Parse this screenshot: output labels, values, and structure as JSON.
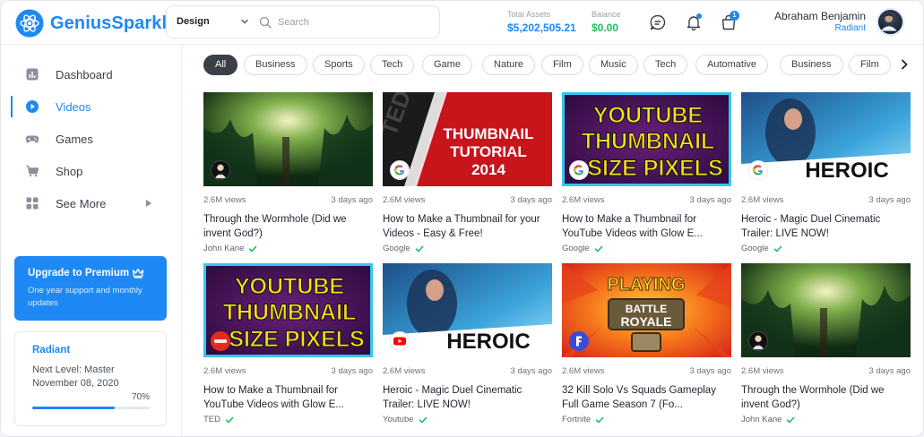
{
  "app": {
    "name": "GeniusSparkle"
  },
  "search": {
    "category": "Design",
    "placeholder": "Search"
  },
  "stats": {
    "total_assets_label": "Total Assets",
    "total_assets_value": "$5,202,505.21",
    "balance_label": "Balance",
    "balance_value": "$0.00"
  },
  "header_icons": {
    "chat": "chat-icon",
    "bell": "bell-icon",
    "bag": "shopping-bag-icon",
    "bag_badge": "1"
  },
  "user": {
    "name": "Abraham Benjamin",
    "role": "Radiant"
  },
  "sidebar": {
    "items": [
      {
        "label": "Dashboard",
        "icon": "bar-chart-icon"
      },
      {
        "label": "Videos",
        "icon": "play-circle-icon",
        "active": true
      },
      {
        "label": "Games",
        "icon": "gamepad-icon"
      },
      {
        "label": "Shop",
        "icon": "cart-icon"
      },
      {
        "label": "See More",
        "icon": "grid-icon"
      }
    ],
    "premium": {
      "title": "Upgrade to Premium",
      "subtitle": "One year support and monthly updates"
    },
    "level": {
      "title": "Radiant",
      "next": "Next Level: Master",
      "date": "November 08, 2020",
      "progress_label": "70%",
      "progress": 0.7
    }
  },
  "chips": [
    "All",
    "Business",
    "Sports",
    "Tech",
    "Game",
    "Nature",
    "Film",
    "Music",
    "Tech",
    "Automative",
    "Business",
    "Film"
  ],
  "colors": {
    "accent": "#1e88f5",
    "success": "#20c060"
  },
  "videos": [
    {
      "views": "2.6M views",
      "ago": "3 days ago",
      "title": "Through the Wormhole (Did we invent God?)",
      "channel": "John Kane"
    },
    {
      "views": "2.6M views",
      "ago": "3 days ago",
      "title": "How to Make a Thumbnail for your Videos - Easy & Free!",
      "channel": "Google",
      "thumb_text": [
        "THUMBNAIL",
        "TUTORIAL",
        "2014"
      ]
    },
    {
      "views": "2.6M views",
      "ago": "3 days ago",
      "title": "How to Make a Thumbnail for YouTube Videos with Glow E...",
      "channel": "Google",
      "thumb_text": [
        "YOUTUBE",
        "THUMBNAIL",
        "SIZE PIXELS"
      ]
    },
    {
      "views": "2.6M views",
      "ago": "3 days ago",
      "title": "Heroic - Magic Duel Cinematic Trailer: LIVE NOW!",
      "channel": "Google",
      "thumb_text": [
        "HEROIC"
      ]
    },
    {
      "views": "2.6M views",
      "ago": "3 days ago",
      "title": "How to Make a Thumbnail for YouTube Videos with Glow E...",
      "channel": "TED",
      "thumb_text": [
        "YOUTUBE",
        "THUMBNAIL",
        "SIZE PIXELS"
      ]
    },
    {
      "views": "2.6M views",
      "ago": "3 days ago",
      "title": "Heroic - Magic Duel Cinematic Trailer: LIVE NOW!",
      "channel": "Youtube",
      "thumb_text": [
        "HEROIC"
      ]
    },
    {
      "views": "2.6M views",
      "ago": "3 days ago",
      "title": "32 Kill Solo Vs Squads Gameplay Full Game Season 7 (Fo...",
      "channel": "Fortnite",
      "thumb_text": [
        "PLAYING",
        "BATTLE",
        "ROYALE"
      ]
    },
    {
      "views": "2.6M views",
      "ago": "3 days ago",
      "title": "Through the Wormhole (Did we invent God?)",
      "channel": "John Kane"
    }
  ]
}
